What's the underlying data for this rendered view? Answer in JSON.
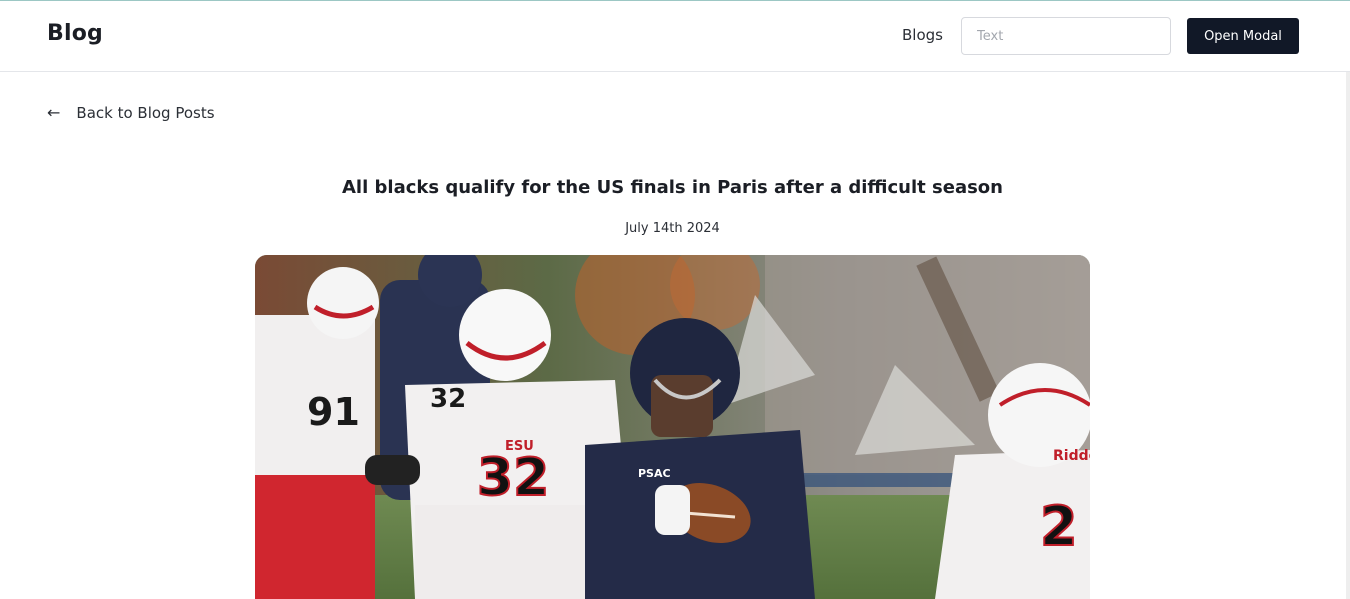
{
  "header": {
    "brand": "Blog",
    "nav_link": "Blogs",
    "search_placeholder": "Text",
    "search_value": "",
    "modal_button": "Open Modal"
  },
  "back_link": {
    "arrow": "←",
    "label": "Back to Blog Posts"
  },
  "post": {
    "title": "All blacks qualify for the US finals in Paris after a difficult season",
    "date": "July 14th 2024",
    "image": {
      "jersey_numbers": [
        "91",
        "32",
        "32",
        "2"
      ],
      "jersey_text": [
        "ESU",
        "PSAC",
        "Riddell"
      ]
    }
  },
  "colors": {
    "primary_button": "#111827",
    "border": "#e4e6ea",
    "accent_top": "#9cc7c4"
  }
}
